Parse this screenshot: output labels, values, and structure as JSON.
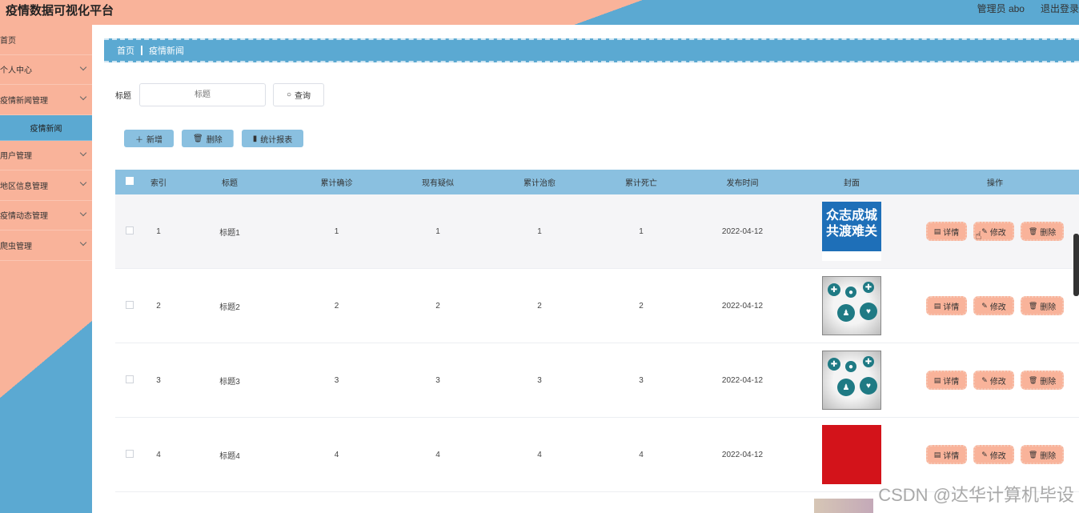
{
  "app": {
    "title": "疫情数据可视化平台",
    "user": "管理员 abo",
    "logout": "退出登录"
  },
  "sidebar": {
    "items": [
      {
        "label": "首页",
        "has_children": false
      },
      {
        "label": "个人中心",
        "has_children": true
      },
      {
        "label": "疫情新闻管理",
        "has_children": true
      },
      {
        "label": "疫情新闻",
        "is_sub": true
      },
      {
        "label": "用户管理",
        "has_children": true
      },
      {
        "label": "地区信息管理",
        "has_children": true
      },
      {
        "label": "疫情动态管理",
        "has_children": true
      },
      {
        "label": "爬虫管理",
        "has_children": true
      }
    ]
  },
  "breadcrumb": {
    "home": "首页",
    "current": "疫情新闻"
  },
  "search": {
    "label": "标题",
    "placeholder": "标题",
    "button": "查询"
  },
  "actions": {
    "add": "新增",
    "delete": "删除",
    "stats": "统计报表"
  },
  "table": {
    "headers": [
      "索引",
      "标题",
      "累计确诊",
      "现有疑似",
      "累计治愈",
      "累计死亡",
      "发布时间",
      "封面",
      "操作"
    ],
    "rows": [
      {
        "index": "1",
        "title": "标题1",
        "confirmed": "1",
        "suspected": "1",
        "cured": "1",
        "deaths": "1",
        "date": "2022-04-12",
        "cover": "blue-banner"
      },
      {
        "index": "2",
        "title": "标题2",
        "confirmed": "2",
        "suspected": "2",
        "cured": "2",
        "deaths": "2",
        "date": "2022-04-12",
        "cover": "medical-icons"
      },
      {
        "index": "3",
        "title": "标题3",
        "confirmed": "3",
        "suspected": "3",
        "cured": "3",
        "deaths": "3",
        "date": "2022-04-12",
        "cover": "medical-icons"
      },
      {
        "index": "4",
        "title": "标题4",
        "confirmed": "4",
        "suspected": "4",
        "cured": "4",
        "deaths": "4",
        "date": "2022-04-12",
        "cover": "red-banner"
      }
    ],
    "ops": {
      "detail": "详情",
      "edit": "修改",
      "delete": "删除"
    }
  },
  "covers": {
    "blue_banner_text": [
      "众志成城",
      "共渡难关"
    ]
  },
  "colors": {
    "accent_blue": "#5ba9d2",
    "accent_salmon": "#f9b39a",
    "table_header": "#8ac0e0"
  },
  "watermark": "CSDN @达华计算机毕设"
}
